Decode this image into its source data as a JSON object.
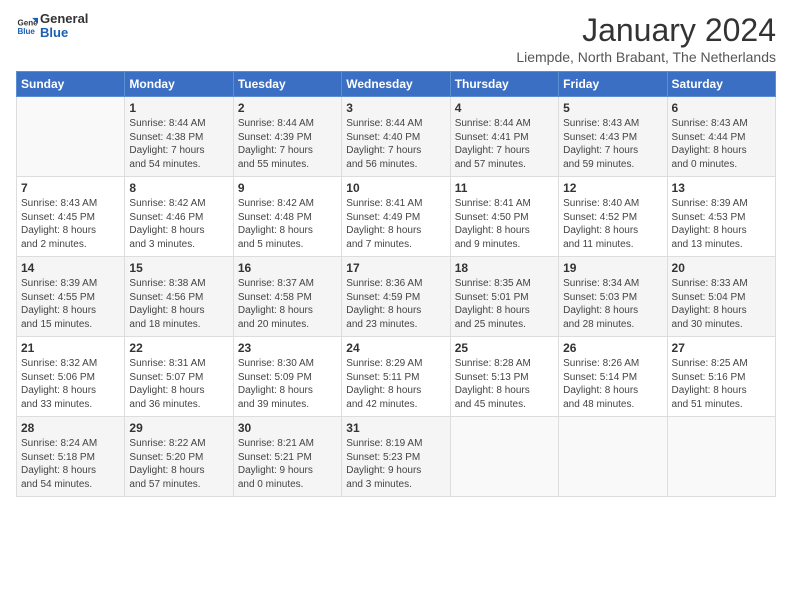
{
  "header": {
    "logo_general": "General",
    "logo_blue": "Blue",
    "title": "January 2024",
    "subtitle": "Liempde, North Brabant, The Netherlands"
  },
  "weekdays": [
    "Sunday",
    "Monday",
    "Tuesday",
    "Wednesday",
    "Thursday",
    "Friday",
    "Saturday"
  ],
  "weeks": [
    [
      {
        "day": "",
        "content": ""
      },
      {
        "day": "1",
        "content": "Sunrise: 8:44 AM\nSunset: 4:38 PM\nDaylight: 7 hours\nand 54 minutes."
      },
      {
        "day": "2",
        "content": "Sunrise: 8:44 AM\nSunset: 4:39 PM\nDaylight: 7 hours\nand 55 minutes."
      },
      {
        "day": "3",
        "content": "Sunrise: 8:44 AM\nSunset: 4:40 PM\nDaylight: 7 hours\nand 56 minutes."
      },
      {
        "day": "4",
        "content": "Sunrise: 8:44 AM\nSunset: 4:41 PM\nDaylight: 7 hours\nand 57 minutes."
      },
      {
        "day": "5",
        "content": "Sunrise: 8:43 AM\nSunset: 4:43 PM\nDaylight: 7 hours\nand 59 minutes."
      },
      {
        "day": "6",
        "content": "Sunrise: 8:43 AM\nSunset: 4:44 PM\nDaylight: 8 hours\nand 0 minutes."
      }
    ],
    [
      {
        "day": "7",
        "content": "Sunrise: 8:43 AM\nSunset: 4:45 PM\nDaylight: 8 hours\nand 2 minutes."
      },
      {
        "day": "8",
        "content": "Sunrise: 8:42 AM\nSunset: 4:46 PM\nDaylight: 8 hours\nand 3 minutes."
      },
      {
        "day": "9",
        "content": "Sunrise: 8:42 AM\nSunset: 4:48 PM\nDaylight: 8 hours\nand 5 minutes."
      },
      {
        "day": "10",
        "content": "Sunrise: 8:41 AM\nSunset: 4:49 PM\nDaylight: 8 hours\nand 7 minutes."
      },
      {
        "day": "11",
        "content": "Sunrise: 8:41 AM\nSunset: 4:50 PM\nDaylight: 8 hours\nand 9 minutes."
      },
      {
        "day": "12",
        "content": "Sunrise: 8:40 AM\nSunset: 4:52 PM\nDaylight: 8 hours\nand 11 minutes."
      },
      {
        "day": "13",
        "content": "Sunrise: 8:39 AM\nSunset: 4:53 PM\nDaylight: 8 hours\nand 13 minutes."
      }
    ],
    [
      {
        "day": "14",
        "content": "Sunrise: 8:39 AM\nSunset: 4:55 PM\nDaylight: 8 hours\nand 15 minutes."
      },
      {
        "day": "15",
        "content": "Sunrise: 8:38 AM\nSunset: 4:56 PM\nDaylight: 8 hours\nand 18 minutes."
      },
      {
        "day": "16",
        "content": "Sunrise: 8:37 AM\nSunset: 4:58 PM\nDaylight: 8 hours\nand 20 minutes."
      },
      {
        "day": "17",
        "content": "Sunrise: 8:36 AM\nSunset: 4:59 PM\nDaylight: 8 hours\nand 23 minutes."
      },
      {
        "day": "18",
        "content": "Sunrise: 8:35 AM\nSunset: 5:01 PM\nDaylight: 8 hours\nand 25 minutes."
      },
      {
        "day": "19",
        "content": "Sunrise: 8:34 AM\nSunset: 5:03 PM\nDaylight: 8 hours\nand 28 minutes."
      },
      {
        "day": "20",
        "content": "Sunrise: 8:33 AM\nSunset: 5:04 PM\nDaylight: 8 hours\nand 30 minutes."
      }
    ],
    [
      {
        "day": "21",
        "content": "Sunrise: 8:32 AM\nSunset: 5:06 PM\nDaylight: 8 hours\nand 33 minutes."
      },
      {
        "day": "22",
        "content": "Sunrise: 8:31 AM\nSunset: 5:07 PM\nDaylight: 8 hours\nand 36 minutes."
      },
      {
        "day": "23",
        "content": "Sunrise: 8:30 AM\nSunset: 5:09 PM\nDaylight: 8 hours\nand 39 minutes."
      },
      {
        "day": "24",
        "content": "Sunrise: 8:29 AM\nSunset: 5:11 PM\nDaylight: 8 hours\nand 42 minutes."
      },
      {
        "day": "25",
        "content": "Sunrise: 8:28 AM\nSunset: 5:13 PM\nDaylight: 8 hours\nand 45 minutes."
      },
      {
        "day": "26",
        "content": "Sunrise: 8:26 AM\nSunset: 5:14 PM\nDaylight: 8 hours\nand 48 minutes."
      },
      {
        "day": "27",
        "content": "Sunrise: 8:25 AM\nSunset: 5:16 PM\nDaylight: 8 hours\nand 51 minutes."
      }
    ],
    [
      {
        "day": "28",
        "content": "Sunrise: 8:24 AM\nSunset: 5:18 PM\nDaylight: 8 hours\nand 54 minutes."
      },
      {
        "day": "29",
        "content": "Sunrise: 8:22 AM\nSunset: 5:20 PM\nDaylight: 8 hours\nand 57 minutes."
      },
      {
        "day": "30",
        "content": "Sunrise: 8:21 AM\nSunset: 5:21 PM\nDaylight: 9 hours\nand 0 minutes."
      },
      {
        "day": "31",
        "content": "Sunrise: 8:19 AM\nSunset: 5:23 PM\nDaylight: 9 hours\nand 3 minutes."
      },
      {
        "day": "",
        "content": ""
      },
      {
        "day": "",
        "content": ""
      },
      {
        "day": "",
        "content": ""
      }
    ]
  ]
}
